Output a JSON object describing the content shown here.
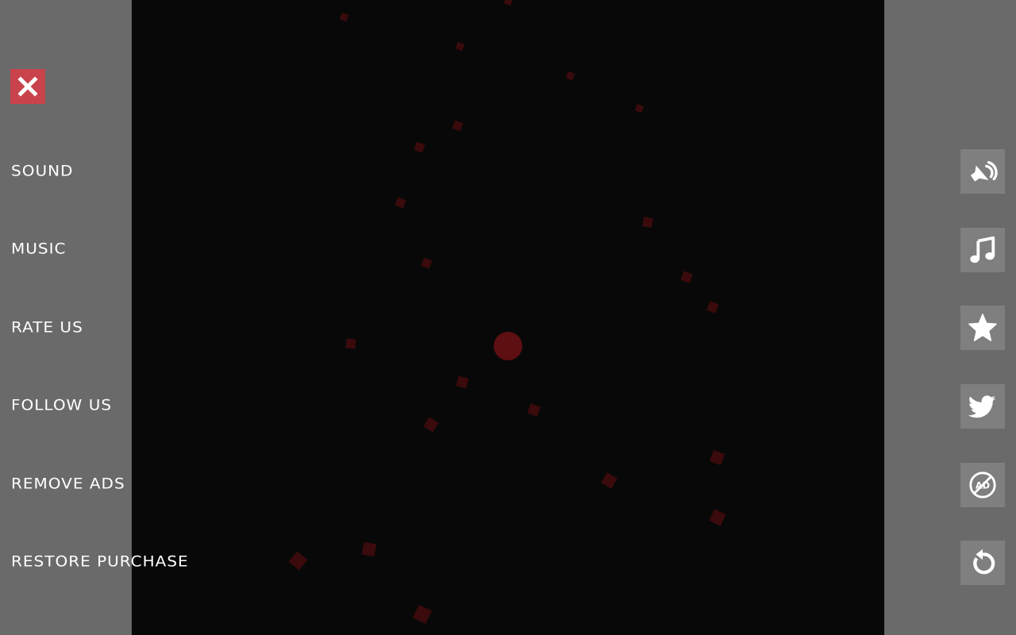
{
  "menu": {
    "items": [
      {
        "label": "SOUND",
        "icon": "sound-muted-icon"
      },
      {
        "label": "MUSIC",
        "icon": "music-note-icon"
      },
      {
        "label": "RATE US",
        "icon": "star-icon"
      },
      {
        "label": "FOLLOW US",
        "icon": "twitter-icon"
      },
      {
        "label": "REMOVE ADS",
        "icon": "no-ads-icon"
      },
      {
        "label": "RESTORE PURCHASE",
        "icon": "restore-icon"
      }
    ]
  },
  "close_icon": "close-icon",
  "colors": {
    "panel": "#6a6a6a",
    "game_background": "#080808",
    "close_button": "#c9434c",
    "icon_button": "#7f7f7f",
    "player_ball": "#5e0f12",
    "particles": "#3a0a0c",
    "text": "#ffffff"
  }
}
